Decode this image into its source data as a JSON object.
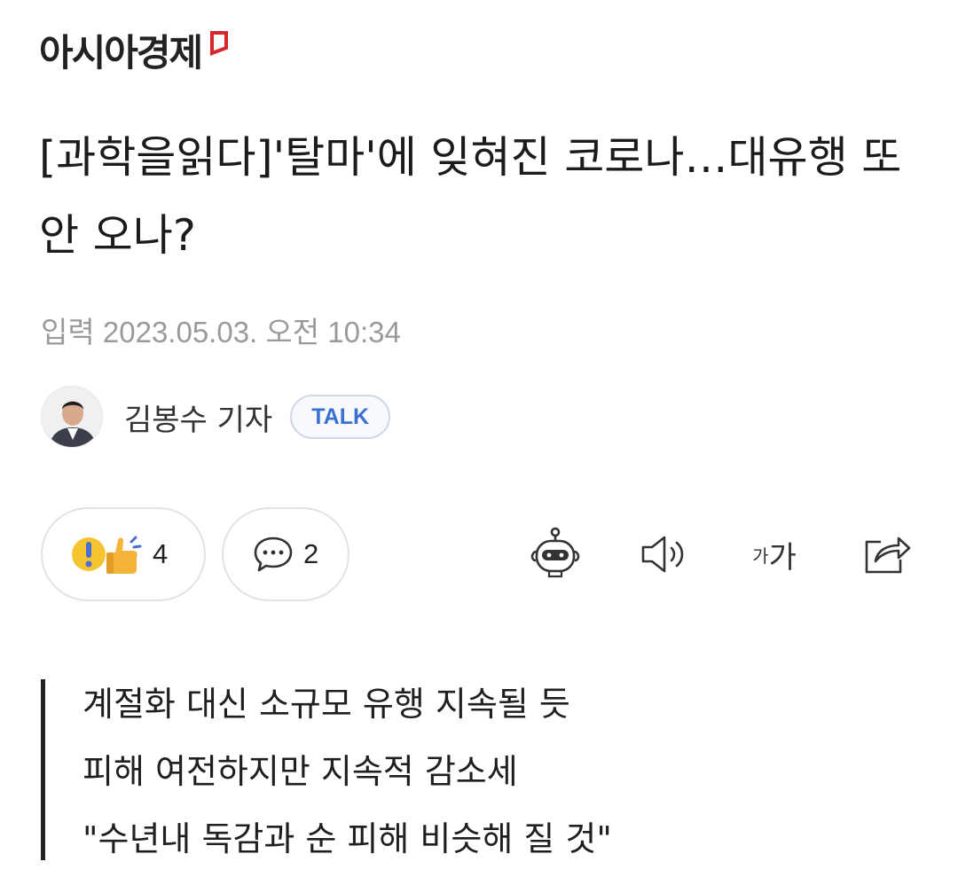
{
  "header": {
    "logo_text": "아시아경제",
    "logo_mark_color": "#d6252b"
  },
  "article": {
    "title": "[과학을읽다]'탈마'에 잊혀진 코로나…대유행 또 안 오나?",
    "published": "입력 2023.05.03. 오전 10:34",
    "reporter": {
      "name": "김봉수 기자",
      "talk_label": "TALK",
      "avatar_icon": "reporter-avatar"
    },
    "reactions": {
      "reaction_count": "4",
      "comment_count": "2"
    },
    "toolbar": {
      "ai_summary_icon": "robot-icon",
      "tts_icon": "speaker-icon",
      "font_small": "가",
      "font_big": "가",
      "share_icon": "share-icon"
    },
    "summary": [
      "계절화 대신 소규모 유행 지속될 듯",
      "피해 여전하지만 지속적 감소세",
      "\"수년내 독감과 순 피해 비슷해 질 것\""
    ]
  },
  "colors": {
    "talk_text": "#3b6fd1",
    "meta_text": "#9a9a9a",
    "accent": "#d6252b"
  }
}
